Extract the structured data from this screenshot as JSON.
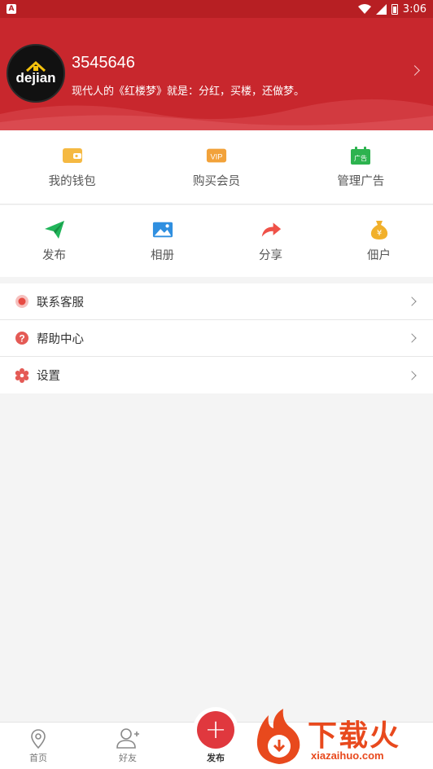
{
  "status_bar": {
    "time": "3:06",
    "app_icon_letter": "A"
  },
  "profile": {
    "avatar_logo_text": "dejian",
    "user_id": "3545646",
    "motto": "现代人的《红楼梦》就是：分红，买楼，还做梦。"
  },
  "quick_actions": [
    {
      "label": "我的钱包",
      "icon": "wallet-icon"
    },
    {
      "label": "购买会员",
      "icon": "vip-icon",
      "badge": "VIP"
    },
    {
      "label": "管理广告",
      "icon": "ad-calendar-icon",
      "badge": "广告"
    }
  ],
  "features": [
    {
      "label": "发布",
      "icon": "paper-plane-icon"
    },
    {
      "label": "相册",
      "icon": "photo-icon"
    },
    {
      "label": "分享",
      "icon": "share-arrow-icon"
    },
    {
      "label": "佃户",
      "icon": "money-bag-icon",
      "badge": "¥"
    }
  ],
  "menu": [
    {
      "label": "联系客服",
      "icon": "customer-service-icon"
    },
    {
      "label": "帮助中心",
      "icon": "help-icon"
    },
    {
      "label": "设置",
      "icon": "settings-gear-icon"
    }
  ],
  "bottom_nav": {
    "home": "首页",
    "friends": "好友",
    "publish": "发布",
    "publish_symbol": "+"
  },
  "watermark": {
    "brand": "下载火",
    "site": "xiazaihuo.com"
  },
  "colors": {
    "brand_red": "#c8272d",
    "status_red": "#b71f23",
    "publish_red": "#e0383e"
  }
}
